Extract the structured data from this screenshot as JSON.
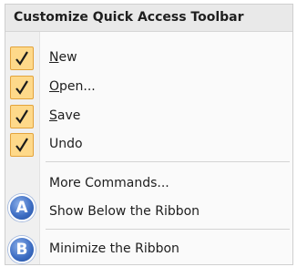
{
  "menu": {
    "title": "Customize Quick Access Toolbar",
    "items": [
      {
        "pre": "",
        "key": "N",
        "post": "ew",
        "checked": true
      },
      {
        "pre": "",
        "key": "O",
        "post": "pen...",
        "checked": true
      },
      {
        "pre": "",
        "key": "S",
        "post": "ave",
        "checked": true
      },
      {
        "pre": "Undo",
        "key": "",
        "post": "",
        "checked": true
      }
    ],
    "more_commands": "More Commands...",
    "show_below": "Show Below the Ribbon",
    "minimize": "Minimize the Ribbon"
  },
  "callouts": {
    "a": "A",
    "b": "B"
  },
  "colors": {
    "check_bg": "#fed98a",
    "check_border": "#e3a33b",
    "badge_blue": "#3f6fc4"
  }
}
